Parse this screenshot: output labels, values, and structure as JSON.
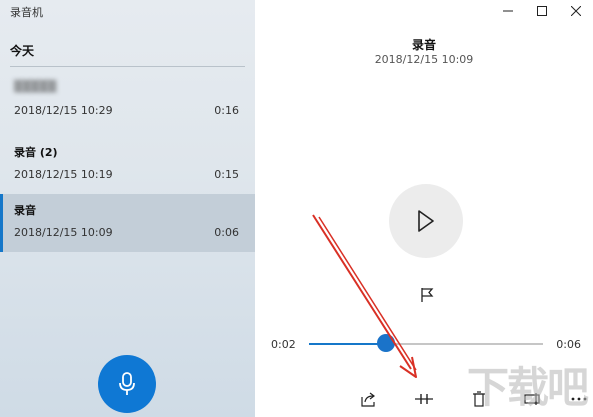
{
  "app": {
    "title": "录音机"
  },
  "list": {
    "group_header": "今天",
    "recordings": [
      {
        "name": "",
        "date": "2018/12/15 10:29",
        "duration": "0:16",
        "selected": false
      },
      {
        "name": "录音 (2)",
        "date": "2018/12/15 10:19",
        "duration": "0:15",
        "selected": false
      },
      {
        "name": "录音",
        "date": "2018/12/15 10:09",
        "duration": "0:06",
        "selected": true
      }
    ]
  },
  "player": {
    "title": "录音",
    "date": "2018/12/15 10:09",
    "current_time": "0:02",
    "total_time": "0:06",
    "progress": 0.33
  },
  "colors": {
    "accent": "#0f78d4",
    "selected_row": "#c3ced8",
    "annotation_arrow": "#d93025"
  },
  "icons": {
    "record": "microphone-icon",
    "play": "play-icon",
    "marker": "flag-icon",
    "share": "share-icon",
    "trim": "trim-icon",
    "delete": "delete-icon",
    "rename": "rename-icon",
    "more": "more-icon"
  },
  "watermark": "下载吧"
}
